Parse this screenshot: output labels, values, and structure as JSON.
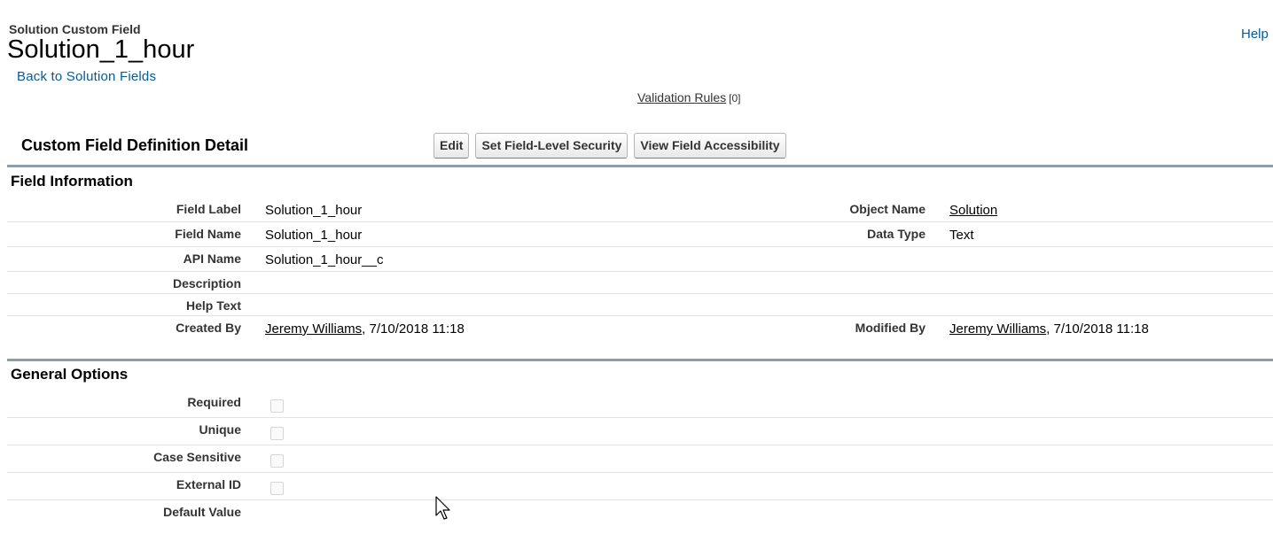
{
  "header": {
    "type_label": "Solution Custom Field",
    "title": "Solution_1_hour",
    "back_link": "Back to Solution Fields",
    "help_link": "Help"
  },
  "related_lists": {
    "validation_rules_label": "Validation Rules",
    "validation_rules_count": "[0]"
  },
  "detail": {
    "title": "Custom Field Definition Detail",
    "buttons": {
      "edit": "Edit",
      "set_fls": "Set Field-Level Security",
      "view_accessibility": "View Field Accessibility"
    }
  },
  "field_information": {
    "title": "Field Information",
    "field_label": {
      "label": "Field Label",
      "value": "Solution_1_hour"
    },
    "field_name": {
      "label": "Field Name",
      "value": "Solution_1_hour"
    },
    "api_name": {
      "label": "API Name",
      "value": "Solution_1_hour__c"
    },
    "description": {
      "label": "Description",
      "value": ""
    },
    "help_text": {
      "label": "Help Text",
      "value": ""
    },
    "created_by": {
      "label": "Created By",
      "user": "Jeremy Williams",
      "date": ", 7/10/2018 11:18"
    },
    "object_name": {
      "label": "Object Name",
      "value": "Solution"
    },
    "data_type": {
      "label": "Data Type",
      "value": "Text"
    },
    "modified_by": {
      "label": "Modified By",
      "user": "Jeremy Williams",
      "date": ", 7/10/2018 11:18"
    }
  },
  "general_options": {
    "title": "General Options",
    "required": {
      "label": "Required",
      "checked": false
    },
    "unique": {
      "label": "Unique",
      "checked": false
    },
    "case_sensitive": {
      "label": "Case Sensitive",
      "checked": false
    },
    "external_id": {
      "label": "External ID",
      "checked": false
    },
    "default_value": {
      "label": "Default Value",
      "value": ""
    }
  },
  "colors": {
    "link": "#015ba7",
    "divider": "#8e9dae",
    "row_border": "#e3e3e3"
  }
}
